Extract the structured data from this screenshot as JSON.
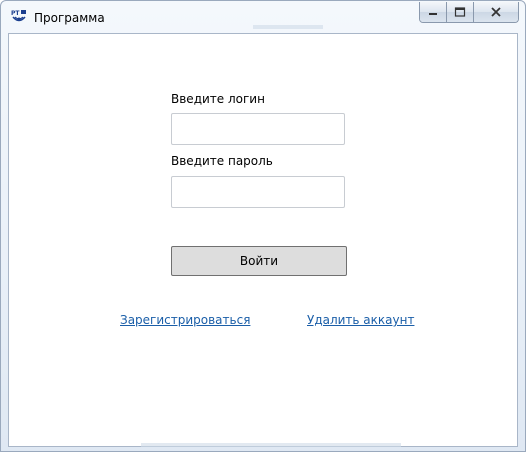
{
  "window": {
    "title": "Программа",
    "controls": {
      "minimize": "minimize-icon",
      "maximize": "maximize-icon",
      "close": "close-icon"
    }
  },
  "form": {
    "login_label": "Введите логин",
    "login_value": "",
    "password_label": "Введите пароль",
    "password_value": "",
    "submit_label": "Войти",
    "register_link": "Зарегистрироваться",
    "delete_link": "Удалить аккаунт"
  },
  "colors": {
    "link": "#1a5ea8",
    "button_bg": "#dddddd",
    "window_frame": "#dfe8f3"
  }
}
